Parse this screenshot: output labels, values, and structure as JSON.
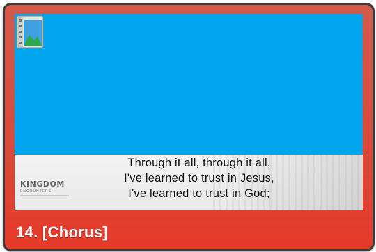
{
  "slide": {
    "caption": "14. [Chorus]",
    "lyrics": [
      "Through it all, through it all,",
      "I've learned to trust in Jesus,",
      "I've learned to trust in God;"
    ],
    "logo": {
      "main": "KINGDOM",
      "sub": "ENCOUNTERS"
    },
    "background_color": "#02a6ee",
    "card_color": "#e63a2a",
    "media_icon": "image-media-icon"
  }
}
